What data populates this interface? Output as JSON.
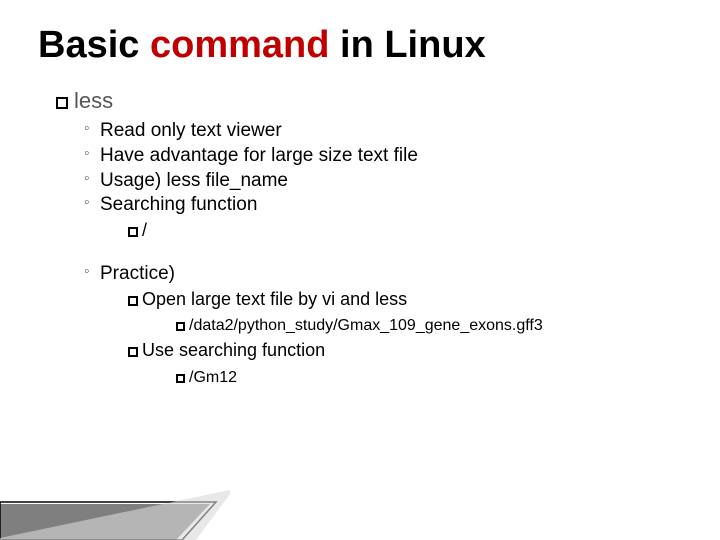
{
  "title_normal_1": "Basic ",
  "title_accent": "command",
  "title_normal_2": " in Linux",
  "sec": {
    "name": "less",
    "points": [
      "Read only text viewer",
      "Have advantage for large size text file",
      "Usage) less file_name",
      "Searching function"
    ],
    "search_sub": "/",
    "practice_label": "Practice)",
    "practice": {
      "p1": "Open large text file by vi and less",
      "p1_path": "/data2/python_study/Gmax_109_gene_exons.gff3",
      "p2": "Use searching function",
      "p2_cmd": "/Gm12"
    }
  }
}
